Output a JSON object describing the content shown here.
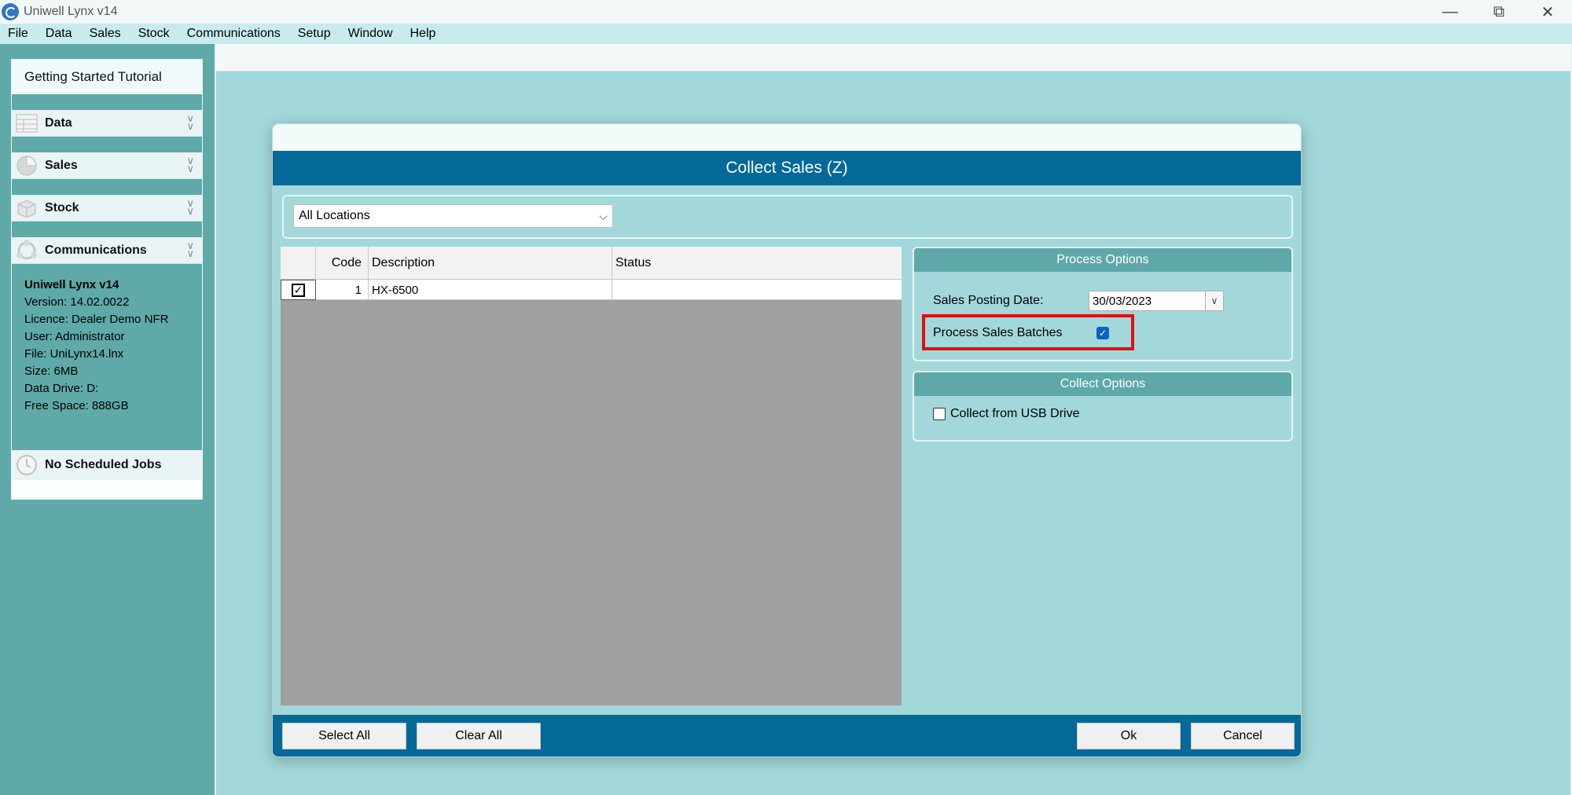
{
  "window": {
    "title": "Uniwell Lynx v14",
    "controls": [
      "minimize",
      "restore",
      "close"
    ]
  },
  "menu": [
    "File",
    "Data",
    "Sales",
    "Stock",
    "Communications",
    "Setup",
    "Window",
    "Help"
  ],
  "sidebar": {
    "tutorial": "Getting Started Tutorial",
    "sections": [
      {
        "label": "Data",
        "icon": "data-table-icon"
      },
      {
        "label": "Sales",
        "icon": "sales-pie-icon"
      },
      {
        "label": "Stock",
        "icon": "stock-box-icon"
      },
      {
        "label": "Communications",
        "icon": "communications-icon"
      }
    ],
    "info": {
      "product": "Uniwell Lynx v14",
      "version": "Version: 14.02.0022",
      "licence": "Licence: Dealer Demo NFR",
      "user": "User: Administrator",
      "file": "File: UniLynx14.lnx",
      "size": "Size: 6MB",
      "drive": "Data Drive: D:",
      "free": "Free Space: 888GB"
    },
    "jobs": "No Scheduled Jobs"
  },
  "dialog": {
    "title": "Collect Sales (Z)",
    "location": "All Locations",
    "grid": {
      "headers": {
        "code": "Code",
        "description": "Description",
        "status": "Status"
      },
      "rows": [
        {
          "checked": true,
          "code": "1",
          "description": "HX-6500",
          "status": ""
        }
      ]
    },
    "process_options": {
      "heading": "Process Options",
      "posting_date_label": "Sales Posting Date:",
      "posting_date": "30/03/2023",
      "batches_label": "Process Sales Batches",
      "batches_checked": true
    },
    "collect_options": {
      "heading": "Collect Options",
      "usb_label": "Collect from USB Drive",
      "usb_checked": false
    },
    "buttons": {
      "select_all": "Select All",
      "clear_all": "Clear All",
      "ok": "Ok",
      "cancel": "Cancel"
    }
  },
  "colors": {
    "header_blue": "#046898",
    "panel_teal": "#5ea8a9",
    "background": "#a2d8da",
    "highlight_red": "#e20d0d",
    "checkbox_blue": "#0a63c4"
  }
}
